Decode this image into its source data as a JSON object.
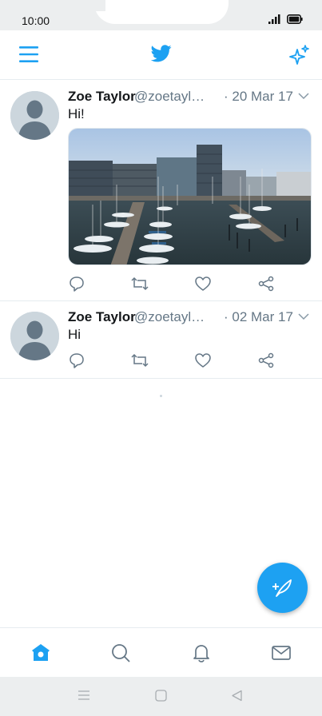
{
  "status_bar": {
    "time": "10:00"
  },
  "colors": {
    "brand": "#1da1f2",
    "text": "#14171a",
    "muted": "#657786",
    "border": "#e6ecf0"
  },
  "header": {
    "menu_icon": "hamburger-icon",
    "logo_icon": "twitter-bird-icon",
    "right_icon": "sparkle-icon"
  },
  "tweets": [
    {
      "name": "Zoe Taylor",
      "handle": "@zoetaylor…",
      "date": "· 20 Mar 17",
      "text": "Hi!",
      "has_media": true,
      "media": "harbour-photo"
    },
    {
      "name": "Zoe Taylor",
      "handle": "@zoetaylor…",
      "date": "· 02 Mar 17",
      "text": "Hi",
      "has_media": false
    }
  ],
  "actions": [
    "reply-icon",
    "retweet-icon",
    "like-icon",
    "share-icon"
  ],
  "bottom_nav": [
    "home-icon",
    "search-icon",
    "notifications-icon",
    "messages-icon"
  ],
  "system_nav": [
    "menu-icon",
    "home-icon",
    "back-icon"
  ]
}
